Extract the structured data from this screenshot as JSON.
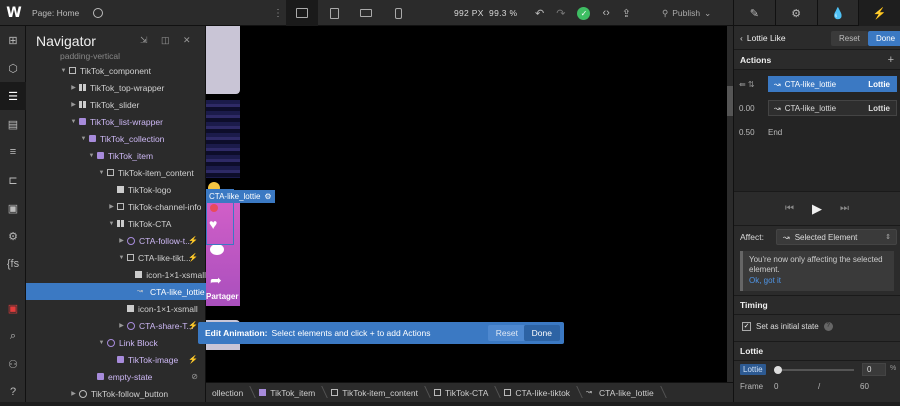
{
  "topbar": {
    "logo": "W",
    "page_label": "Page: Home",
    "width_value": "992",
    "width_unit": "PX",
    "zoom": "99.3 %",
    "publish_label": "Publish"
  },
  "navigator": {
    "title": "Navigator",
    "partial_row": "padding-vertical",
    "rows": [
      {
        "label": "TikTok_component",
        "depth": 0
      },
      {
        "label": "TikTok_top-wrapper",
        "depth": 1
      },
      {
        "label": "TikTok_slider",
        "depth": 1
      },
      {
        "label": "TikTok_list-wrapper",
        "depth": 1
      },
      {
        "label": "TikTok_collection",
        "depth": 2
      },
      {
        "label": "TikTok_item",
        "depth": 3
      },
      {
        "label": "TikTok-item_content",
        "depth": 4
      },
      {
        "label": "TikTok-logo",
        "depth": 5
      },
      {
        "label": "TikTok-channel-info",
        "depth": 5
      },
      {
        "label": "TikTok-CTA",
        "depth": 5
      },
      {
        "label": "CTA-follow-t...",
        "depth": 6
      },
      {
        "label": "CTA-like-tikt...",
        "depth": 6
      },
      {
        "label": "icon-1×1-xsmall",
        "depth": 7
      },
      {
        "label": "CTA-like_lottie",
        "depth": 7
      },
      {
        "label": "icon-1×1-xsmall",
        "depth": 6
      },
      {
        "label": "CTA-share-T...",
        "depth": 6
      },
      {
        "label": "Link Block",
        "depth": 4
      },
      {
        "label": "TikTok-image",
        "depth": 5
      },
      {
        "label": "empty-state",
        "depth": 3
      },
      {
        "label": "TikTok-follow_button",
        "depth": 2
      }
    ]
  },
  "canvas": {
    "selected_label": "CTA-like_lottie",
    "partager": "Partager"
  },
  "edit_bar": {
    "title": "Edit Animation:",
    "hint": "Select elements and click + to add Actions",
    "reset": "Reset",
    "done": "Done"
  },
  "breadcrumbs": [
    "ollection",
    "TikTok_item",
    "TikTok-item_content",
    "TikTok-CTA",
    "CTA-like-tiktok",
    "CTA-like_lottie"
  ],
  "right_panel": {
    "title": "Lottie Like",
    "reset": "Reset",
    "done": "Done",
    "actions_heading": "Actions",
    "actions": [
      {
        "time": "",
        "label": "CTA-like_lottie",
        "tag": "Lottie"
      },
      {
        "time": "0.00",
        "label": "CTA-like_lottie",
        "tag": "Lottie"
      }
    ],
    "end_time": "0.50",
    "end_label": "End",
    "affect_label": "Affect:",
    "affect_value": "Selected Element",
    "notice_text": "You're now only affecting the selected element.",
    "notice_link": "Ok, got it",
    "timing_heading": "Timing",
    "initial_state_label": "Set as initial state",
    "lottie_heading": "Lottie",
    "lottie_badge": "Lottie",
    "lottie_value": "0",
    "lottie_unit": "%",
    "frame_label": "Frame",
    "frame_value": "0",
    "frame_sep": "/",
    "frame_total": "60"
  },
  "colors": {
    "accent": "#3b79c3",
    "success": "#3ebd63",
    "purple": "#a78bdb"
  }
}
